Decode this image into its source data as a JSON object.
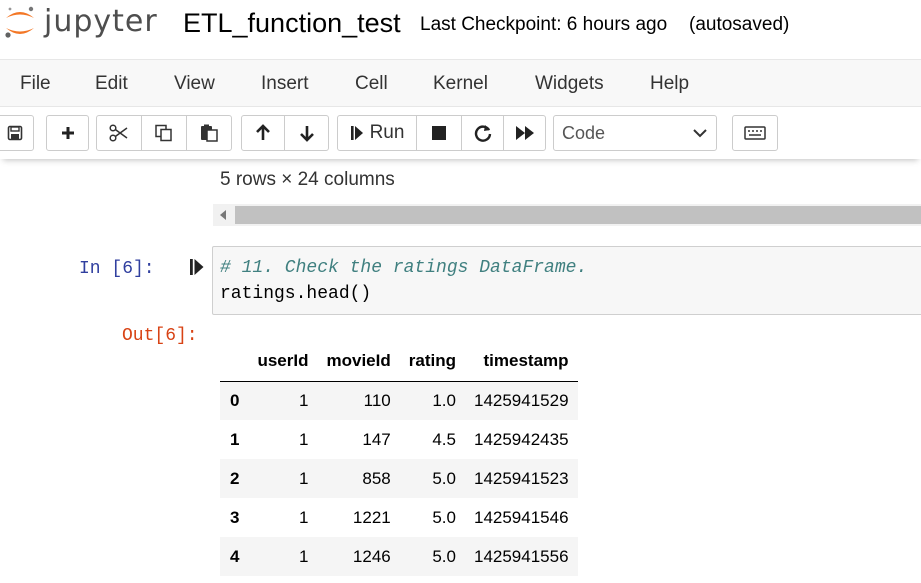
{
  "header": {
    "logo_text": "jupyter",
    "notebook_name": "ETL_function_test",
    "checkpoint": "Last Checkpoint: 6 hours ago",
    "autosave_status": "(autosaved)"
  },
  "menubar": {
    "items": [
      "File",
      "Edit",
      "View",
      "Insert",
      "Cell",
      "Kernel",
      "Widgets",
      "Help"
    ]
  },
  "toolbar": {
    "icons": [
      "save-icon",
      "plus-icon",
      "scissors-icon",
      "copy-icon",
      "paste-icon",
      "arrow-up-icon",
      "arrow-down-icon",
      "run-icon",
      "stop-icon",
      "restart-icon",
      "fast-forward-icon",
      "keyboard-icon"
    ],
    "run_label": "Run",
    "cell_type": "Code"
  },
  "previous_output": {
    "shape_text": "5 rows × 24 columns"
  },
  "cell": {
    "in_prompt": "In [6]:",
    "code_comment": "# 11. Check the ratings DataFrame.",
    "code_line": "ratings.head()",
    "out_prompt": "Out[6]:"
  },
  "dataframe": {
    "columns": [
      "",
      "userId",
      "movieId",
      "rating",
      "timestamp"
    ],
    "rows": [
      [
        "0",
        "1",
        "110",
        "1.0",
        "1425941529"
      ],
      [
        "1",
        "1",
        "147",
        "4.5",
        "1425942435"
      ],
      [
        "2",
        "1",
        "858",
        "5.0",
        "1425941523"
      ],
      [
        "3",
        "1",
        "1221",
        "5.0",
        "1425941546"
      ],
      [
        "4",
        "1",
        "1246",
        "5.0",
        "1425941556"
      ]
    ]
  },
  "colors": {
    "logo_orange": "#f37726",
    "in_prompt": "#303f9f",
    "out_prompt": "#d84315",
    "comment": "#408080"
  }
}
